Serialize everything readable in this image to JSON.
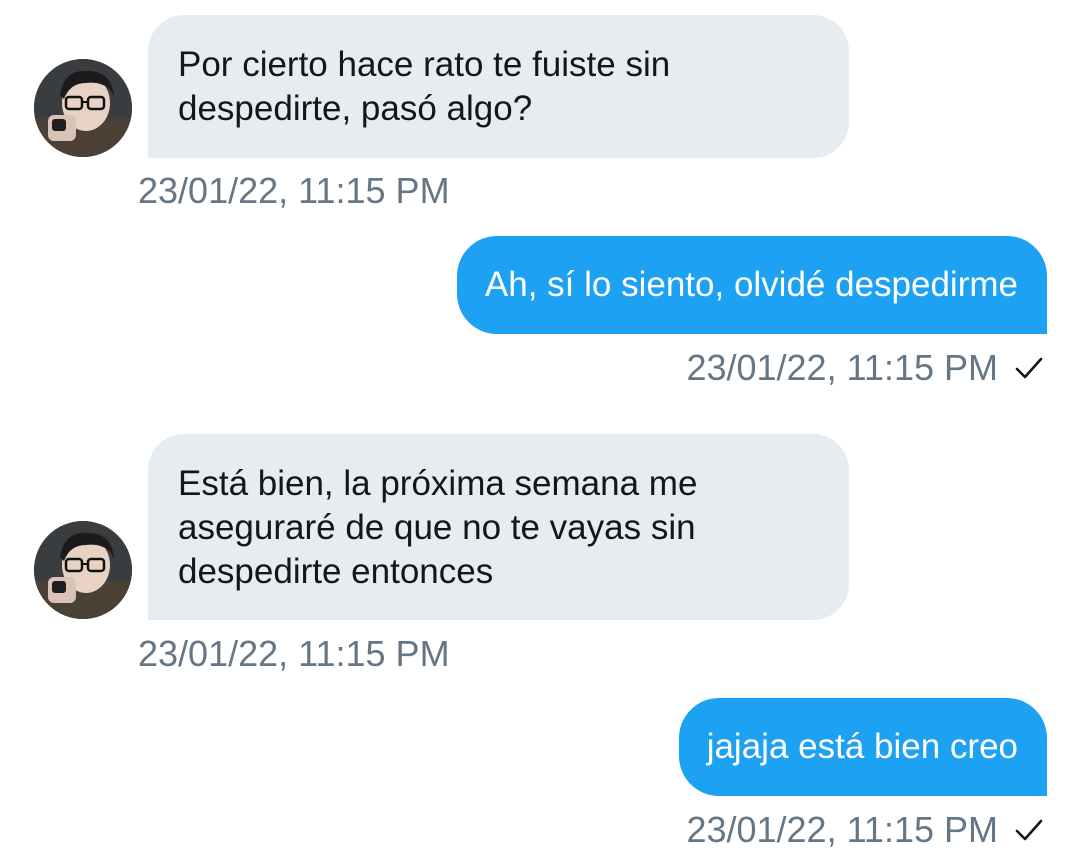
{
  "messages": [
    {
      "direction": "incoming",
      "text": "Por cierto hace rato te fuiste sin\ndespedirte, pasó algo?",
      "timestamp": "23/01/22, 11:15 PM"
    },
    {
      "direction": "outgoing",
      "text": "Ah, sí lo siento, olvidé despedirme",
      "timestamp": "23/01/22, 11:15 PM",
      "status_icon": "checkmark-icon"
    },
    {
      "direction": "incoming",
      "text": "Está bien, la próxima semana me\naseguraré de que no te vayas sin\ndespedirte entonces",
      "timestamp": "23/01/22, 11:15 PM"
    },
    {
      "direction": "outgoing",
      "text": "jajaja está bien creo",
      "timestamp": "23/01/22, 11:15 PM",
      "status_icon": "checkmark-icon"
    }
  ],
  "colors": {
    "incoming_bubble": "#e6ecf0",
    "outgoing_bubble": "#1da1f2",
    "timestamp_text": "#657786"
  }
}
